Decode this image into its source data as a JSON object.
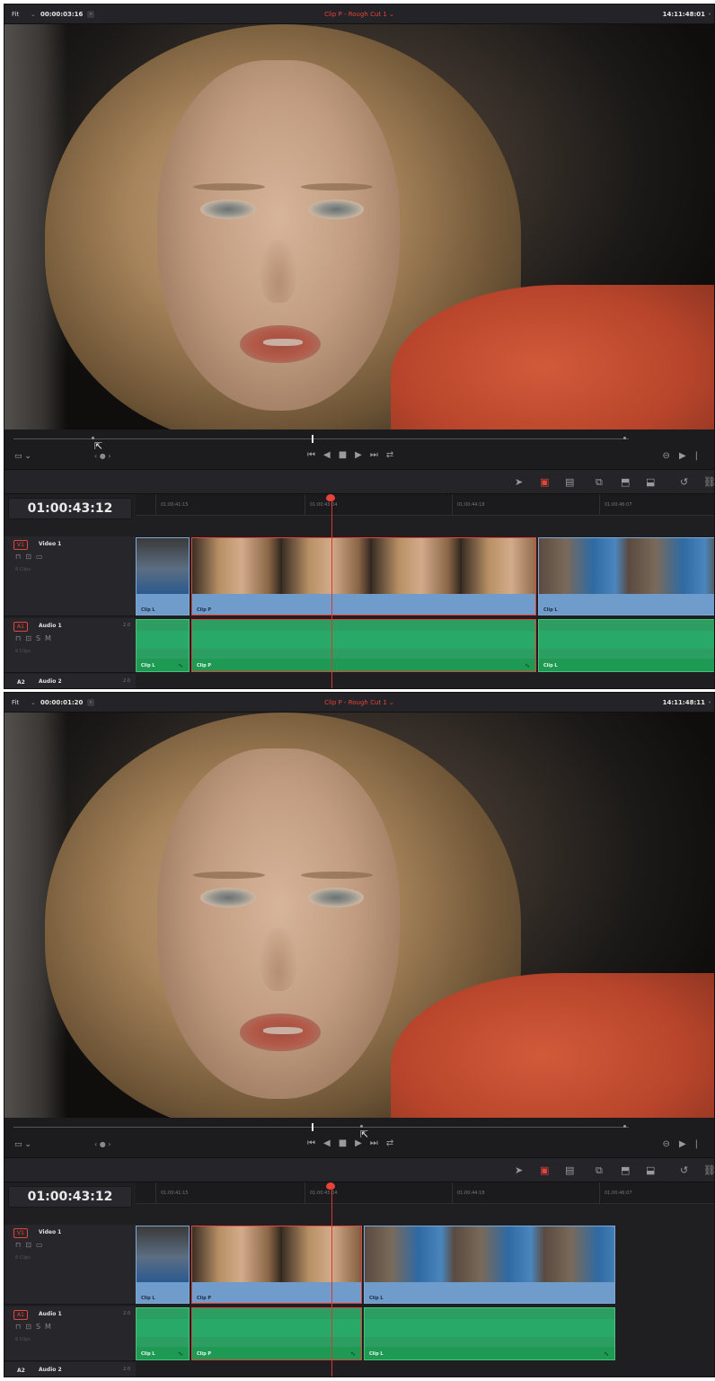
{
  "panels": [
    {
      "topbar": {
        "zoom_label": "Fit",
        "source_timecode": "00:00:03:16",
        "clip_title": "Clip P - Rough Cut 1",
        "clock": "14:11:48:01"
      },
      "timeline": {
        "record_timecode": "01:00:43:12",
        "ruler": [
          "01:00:41:15",
          "01:00:43:04",
          "01:00:44:18",
          "01:00:46:07"
        ],
        "tracks": {
          "v1": {
            "badge": "V1",
            "name": "Video 1",
            "clips_count": "8 Clips"
          },
          "a1": {
            "badge": "A1",
            "name": "Audio 1",
            "channels": "2.0",
            "clips_count": "8 Clips"
          },
          "a2": {
            "badge": "A2",
            "name": "Audio 2",
            "channels": "2.0"
          }
        },
        "video_clips": [
          "Clip L",
          "Clip P",
          "Clip L"
        ],
        "audio_clips": [
          "Clip L",
          "Clip P",
          "Clip L"
        ]
      }
    },
    {
      "topbar": {
        "zoom_label": "Fit",
        "source_timecode": "00:00:01:20",
        "clip_title": "Clip P - Rough Cut 1",
        "clock": "14:11:48:11"
      },
      "timeline": {
        "record_timecode": "01:00:43:12",
        "ruler": [
          "01:00:41:15",
          "01:00:43:04",
          "01:00:44:18",
          "01:00:46:07"
        ],
        "tracks": {
          "v1": {
            "badge": "V1",
            "name": "Video 1",
            "clips_count": "8 Clips"
          },
          "a1": {
            "badge": "A1",
            "name": "Audio 1",
            "channels": "2.0",
            "clips_count": "8 Clips"
          },
          "a2": {
            "badge": "A2",
            "name": "Audio 2",
            "channels": "2.0"
          }
        },
        "video_clips": [
          "Clip L",
          "Clip P",
          "Clip L"
        ],
        "audio_clips": [
          "Clip L",
          "Clip P",
          "Clip L"
        ]
      }
    }
  ],
  "transport": {
    "monitor_icon": "display-icon",
    "jog_icon": "jog-icon",
    "controls": [
      "skip-to-start-icon",
      "play-reverse-icon",
      "stop-icon",
      "play-icon",
      "skip-to-end-icon",
      "loop-icon"
    ]
  },
  "toolbar_tools": [
    "selection-arrow-icon",
    "insert-clip-icon",
    "overwrite-clip-icon",
    "replace-clip-icon",
    "place-on-top-icon",
    "ripple-overwrite-icon",
    "snapping-icon",
    "linked-selection-icon"
  ],
  "colors": {
    "accent_red": "#e5433b",
    "video_clip_blue": "#6f9ccb",
    "audio_clip_green": "#2c9e61",
    "panel_bg": "#1e1e21"
  }
}
